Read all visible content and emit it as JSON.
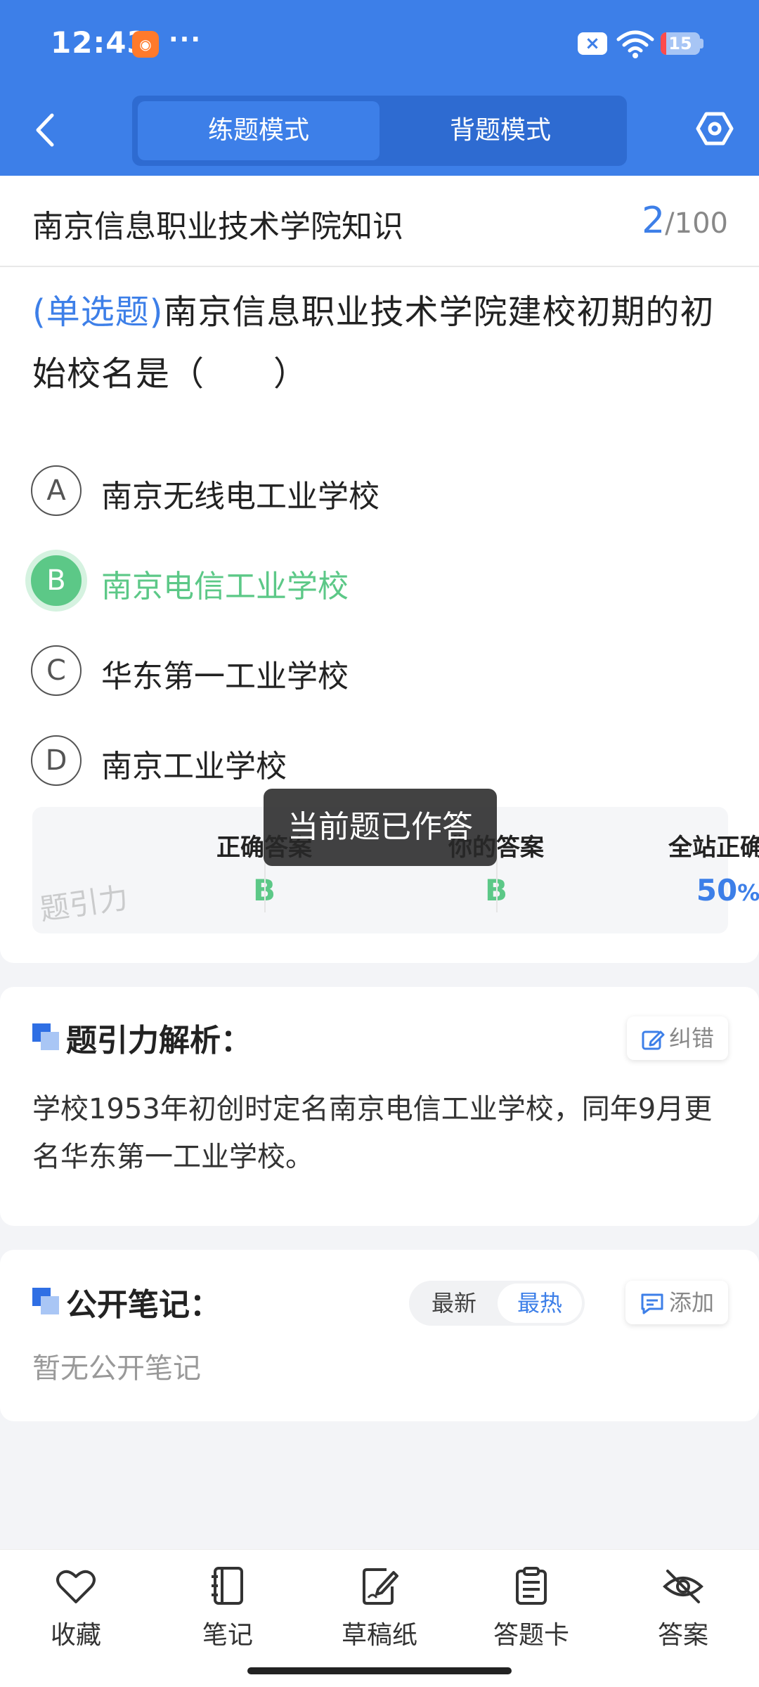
{
  "status_bar": {
    "time": "12:43",
    "dots": "···",
    "battery": "15",
    "battery_level": 0.15
  },
  "header": {
    "tabs": [
      {
        "label": "练题模式",
        "active": true
      },
      {
        "label": "背题模式",
        "active": false
      }
    ]
  },
  "question_card": {
    "bank_title": "南京信息职业技术学院知识",
    "progress_current": "2",
    "progress_total": "/100",
    "question_type": "(单选题)",
    "question_text": "南京信息职业技术学院建校初期的初始校名是（　　）",
    "options": [
      {
        "letter": "A",
        "text": "南京无线电工业学校",
        "selected": false
      },
      {
        "letter": "B",
        "text": "南京电信工业学校",
        "selected": true
      },
      {
        "letter": "C",
        "text": "华东第一工业学校",
        "selected": false
      },
      {
        "letter": "D",
        "text": "南京工业学校",
        "selected": false
      }
    ],
    "results": {
      "correct_label": "正确答案",
      "correct_value": "B",
      "your_label": "你的答案",
      "your_value": "B",
      "rate_label": "全站正确率",
      "rate_value": "50",
      "rate_unit": "%"
    },
    "watermark": "题引力",
    "toast": "当前题已作答"
  },
  "analysis": {
    "title": "题引力解析：",
    "report_button": "纠错",
    "text": "学校1953年初创时定名南京电信工业学校，同年9月更名华东第一工业学校。"
  },
  "notes": {
    "title": "公开笔记：",
    "sort_options": [
      "最新",
      "最热"
    ],
    "add_button": "添加",
    "empty_text": "暂无公开笔记"
  },
  "bottom_nav": [
    {
      "label": "收藏",
      "icon": "heart-icon"
    },
    {
      "label": "笔记",
      "icon": "notebook-icon"
    },
    {
      "label": "草稿纸",
      "icon": "draft-icon"
    },
    {
      "label": "答题卡",
      "icon": "answer-sheet-icon"
    },
    {
      "label": "答案",
      "icon": "eye-off-icon"
    }
  ],
  "colors": {
    "brand_blue": "#3d7fe8",
    "correct_green": "#5cc887"
  }
}
